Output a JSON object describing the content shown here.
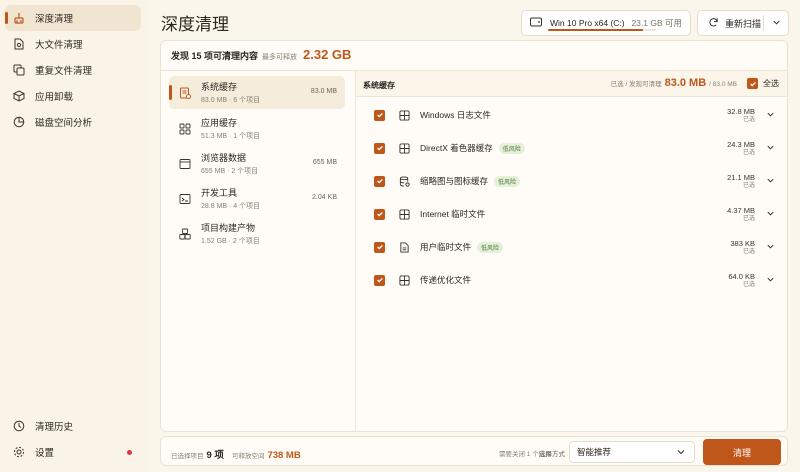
{
  "sidebar": {
    "items": [
      {
        "label": "深度清理",
        "icon": "broom-icon",
        "active": true
      },
      {
        "label": "大文件清理",
        "icon": "file-search-icon"
      },
      {
        "label": "重复文件清理",
        "icon": "copy-icon"
      },
      {
        "label": "应用卸载",
        "icon": "package-icon"
      },
      {
        "label": "磁盘空间分析",
        "icon": "pie-chart-icon"
      }
    ],
    "history_label": "清理历史",
    "settings_label": "设置"
  },
  "header": {
    "title": "深度清理",
    "drive_label": "Win 10 Pro x64 (C:)",
    "drive_free": "23.1 GB 可用",
    "drive_used_fraction": 0.88,
    "rescan_label": "重新扫描"
  },
  "summary": {
    "prefix": "发现 15 项可清理内容",
    "sub": "最多可释放",
    "total": "2.32 GB"
  },
  "categories": [
    {
      "name": "系统缓存",
      "meta": "83.0 MB · 6 个项目",
      "size": "83.0 MB",
      "icon": "system-cache-icon",
      "active": true
    },
    {
      "name": "应用缓存",
      "meta": "51.3 MB · 1 个项目",
      "size": "",
      "icon": "app-grid-icon"
    },
    {
      "name": "浏览器数据",
      "meta": "655 MB · 2 个项目",
      "size": "655 MB",
      "icon": "browser-icon"
    },
    {
      "name": "开发工具",
      "meta": "28.8 MB · 4 个项目",
      "size": "2.04 KB",
      "icon": "terminal-icon"
    },
    {
      "name": "项目构建产物",
      "meta": "1.52 GB · 2 个项目",
      "size": "",
      "icon": "cubes-icon"
    }
  ],
  "detail": {
    "title": "系统缓存",
    "selected_prefix": "已选 / 发现可清理",
    "selected_value": "83.0 MB",
    "selected_suffix": "/ 83.0 MB",
    "select_all_label": "全选",
    "items": [
      {
        "name": "Windows 日志文件",
        "size": "32.8 MB",
        "state": "已选",
        "tag": "",
        "icon": "window-icon"
      },
      {
        "name": "DirectX 着色器缓存",
        "size": "24.3 MB",
        "state": "已选",
        "tag": "低风险",
        "icon": "window-icon"
      },
      {
        "name": "缩略图与图标缓存",
        "size": "21.1 MB",
        "state": "已选",
        "tag": "低风险",
        "icon": "database-icon"
      },
      {
        "name": "Internet 临时文件",
        "size": "4.37 MB",
        "state": "已选",
        "tag": "",
        "icon": "window-icon"
      },
      {
        "name": "用户临时文件",
        "size": "383 KB",
        "state": "已选",
        "tag": "低风险",
        "icon": "file-icon"
      },
      {
        "name": "传递优化文件",
        "size": "64.0 KB",
        "state": "已选",
        "tag": "",
        "icon": "window-icon"
      }
    ]
  },
  "footer": {
    "selected_items_label": "已选择项目",
    "selected_items_value": "9 项",
    "free_space_label": "可释放空间",
    "free_space_value": "738 MB",
    "note": "需要关闭 1 个应用",
    "mode_label": "选择方式",
    "mode_value": "智能推荐",
    "clean_label": "清理"
  },
  "colors": {
    "accent": "#c0571a",
    "background": "#fbf6ec",
    "risk_tag": "#e5efd9"
  }
}
